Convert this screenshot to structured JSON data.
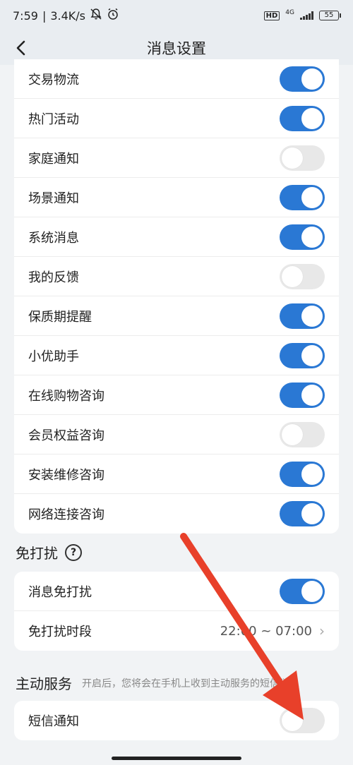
{
  "status_bar": {
    "time": "7:59",
    "speed": "3.4K/s",
    "network": "4G",
    "hd": "HD",
    "battery": "55"
  },
  "header": {
    "title": "消息设置"
  },
  "notifications": [
    {
      "label": "交易物流",
      "on": true
    },
    {
      "label": "热门活动",
      "on": true
    },
    {
      "label": "家庭通知",
      "on": false
    },
    {
      "label": "场景通知",
      "on": true
    },
    {
      "label": "系统消息",
      "on": true
    },
    {
      "label": "我的反馈",
      "on": false
    },
    {
      "label": "保质期提醒",
      "on": true
    },
    {
      "label": "小优助手",
      "on": true
    },
    {
      "label": "在线购物咨询",
      "on": true
    },
    {
      "label": "会员权益咨询",
      "on": false
    },
    {
      "label": "安装维修咨询",
      "on": true
    },
    {
      "label": "网络连接咨询",
      "on": true
    }
  ],
  "dnd": {
    "title": "免打扰",
    "toggle_label": "消息免打扰",
    "toggle_on": true,
    "period_label": "免打扰时段",
    "period_value": "22:00 ~ 07:00"
  },
  "service": {
    "title": "主动服务",
    "desc": "开启后，您将会在手机上收到主动服务的短信消息",
    "sms_label": "短信通知",
    "sms_on": false
  },
  "colors": {
    "accent": "#2a78d4",
    "annotation_arrow": "#e8402a"
  }
}
